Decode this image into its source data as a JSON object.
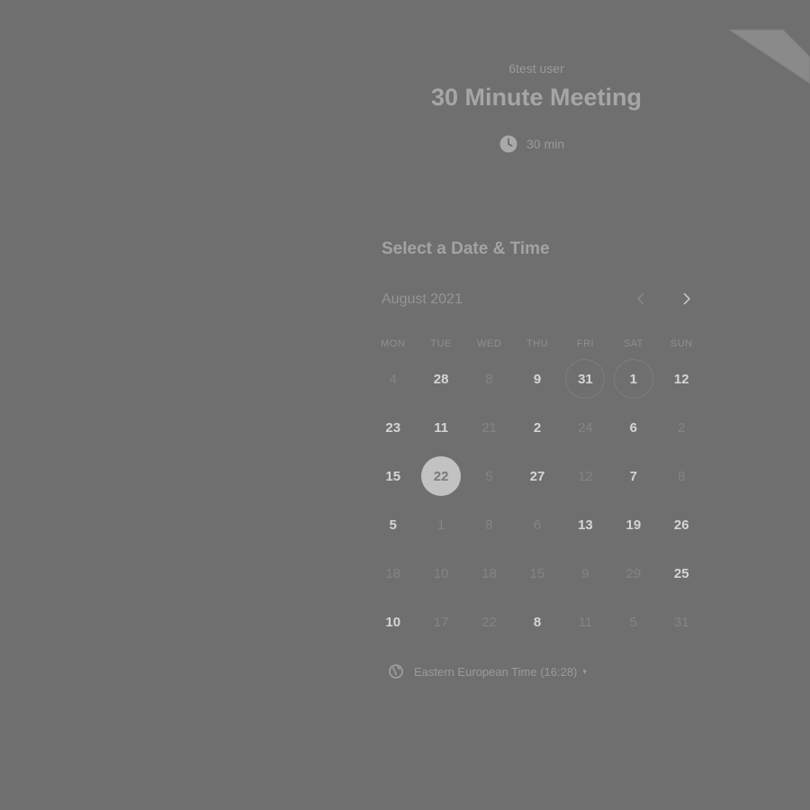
{
  "event": {
    "owner_name": "6test user",
    "title": "30 Minute Meeting",
    "duration": "30 min"
  },
  "calendar": {
    "heading": "Select a Date & Time",
    "month_label": "August 2021",
    "weekdays": [
      "MON",
      "TUE",
      "WED",
      "THU",
      "FRI",
      "SAT",
      "SUN"
    ],
    "weeks": [
      [
        {
          "label": "4",
          "available": false
        },
        {
          "label": "28",
          "available": true
        },
        {
          "label": "8",
          "available": false
        },
        {
          "label": "9",
          "available": true
        },
        {
          "label": "31",
          "available": true,
          "outlined": true
        },
        {
          "label": "1",
          "available": true,
          "outlined": true
        },
        {
          "label": "12",
          "available": true
        }
      ],
      [
        {
          "label": "23",
          "available": true
        },
        {
          "label": "11",
          "available": true
        },
        {
          "label": "21",
          "available": false
        },
        {
          "label": "2",
          "available": true
        },
        {
          "label": "24",
          "available": false
        },
        {
          "label": "6",
          "available": true
        },
        {
          "label": "2",
          "available": false
        }
      ],
      [
        {
          "label": "15",
          "available": true
        },
        {
          "label": "22",
          "available": true,
          "selected": true
        },
        {
          "label": "5",
          "available": false
        },
        {
          "label": "27",
          "available": true
        },
        {
          "label": "12",
          "available": false
        },
        {
          "label": "7",
          "available": true
        },
        {
          "label": "8",
          "available": false
        }
      ],
      [
        {
          "label": "5",
          "available": true
        },
        {
          "label": "1",
          "available": false
        },
        {
          "label": "8",
          "available": false
        },
        {
          "label": "6",
          "available": false
        },
        {
          "label": "13",
          "available": true
        },
        {
          "label": "19",
          "available": true
        },
        {
          "label": "26",
          "available": true
        }
      ],
      [
        {
          "label": "18",
          "available": false
        },
        {
          "label": "10",
          "available": false
        },
        {
          "label": "18",
          "available": false
        },
        {
          "label": "15",
          "available": false
        },
        {
          "label": "9",
          "available": false
        },
        {
          "label": "29",
          "available": false
        },
        {
          "label": "25",
          "available": true
        }
      ],
      [
        {
          "label": "10",
          "available": true
        },
        {
          "label": "17",
          "available": false
        },
        {
          "label": "22",
          "available": false
        },
        {
          "label": "8",
          "available": true
        },
        {
          "label": "11",
          "available": false
        },
        {
          "label": "5",
          "available": false
        },
        {
          "label": "31",
          "available": false
        }
      ]
    ]
  },
  "timezone": {
    "label": "Eastern European Time (16:28)"
  },
  "icons": {
    "clock": "clock-icon",
    "globe": "globe-icon",
    "prev": "chevron-left-icon",
    "next": "chevron-right-icon",
    "caret": "caret-down-icon"
  },
  "colors": {
    "overlay": "#6f6f6f",
    "selected_day": "#c2c2c2"
  }
}
